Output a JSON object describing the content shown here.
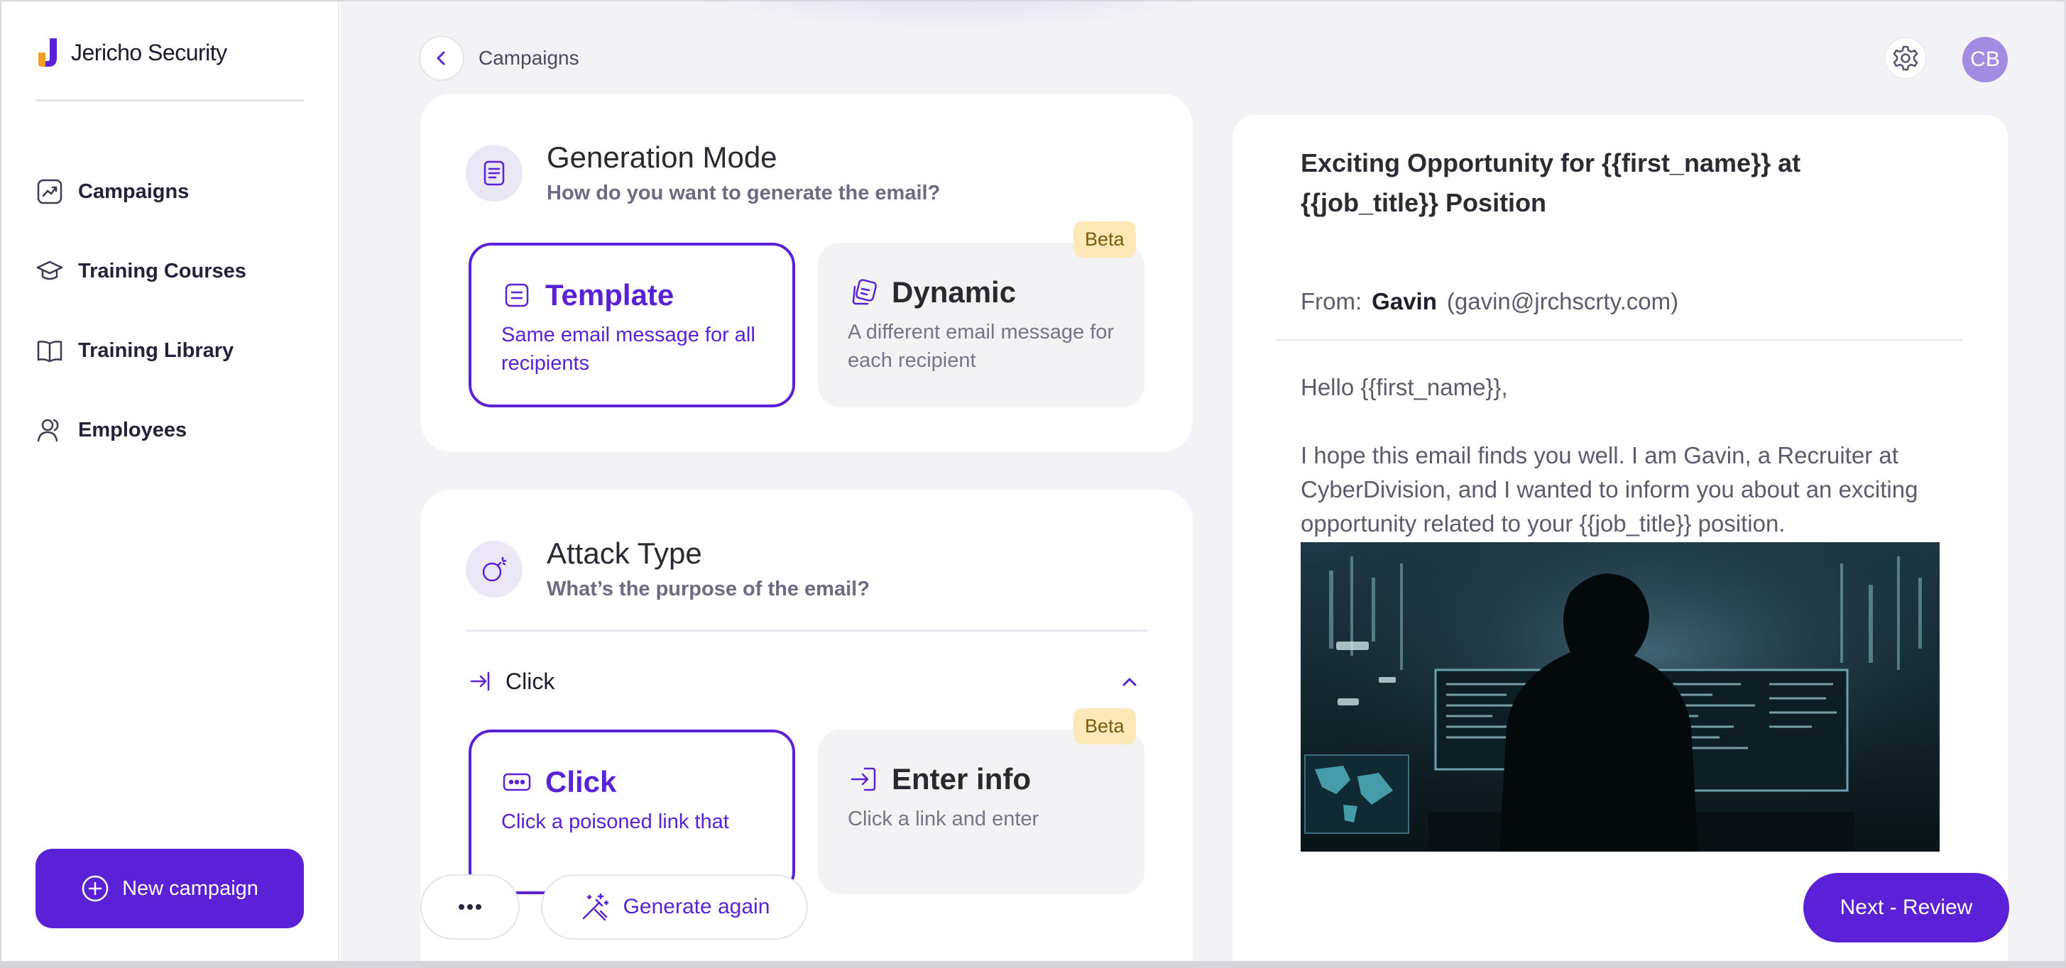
{
  "app": {
    "brand_name": "Jericho Security",
    "accent_color": "#5b21d6"
  },
  "sidebar": {
    "items": [
      {
        "label": "Campaigns",
        "icon": "trending-chart-icon"
      },
      {
        "label": "Training Courses",
        "icon": "graduation-cap-icon"
      },
      {
        "label": "Training Library",
        "icon": "open-book-icon"
      },
      {
        "label": "Employees",
        "icon": "users-icon"
      }
    ],
    "new_campaign_label": "New campaign"
  },
  "header": {
    "breadcrumb": "Campaigns",
    "avatar_initials": "CB"
  },
  "generation_mode": {
    "title": "Generation Mode",
    "subtitle": "How do you want to generate the email?",
    "options": [
      {
        "title": "Template",
        "description": "Same email message for all recipients",
        "selected": true
      },
      {
        "title": "Dynamic",
        "description": "A different email message for each recipient",
        "selected": false,
        "badge": "Beta"
      }
    ]
  },
  "attack_type": {
    "title": "Attack Type",
    "subtitle": "What’s the purpose of the email?",
    "dropdown_value": "Click",
    "options": [
      {
        "title": "Click",
        "description": "Click a poisoned link that",
        "selected": true
      },
      {
        "title": "Enter info",
        "description": "Click a link and enter",
        "selected": false,
        "badge": "Beta"
      }
    ]
  },
  "preview": {
    "subject": "Exciting Opportunity for {{first_name}} at {{job_title}} Position",
    "from_label": "From:",
    "from_name": "Gavin",
    "from_email": "(gavin@jrchscrty.com)",
    "greeting": "Hello {{first_name}},",
    "body": "I hope this email finds you well. I am Gavin, a Recruiter at CyberDivision, and I wanted to inform you about an exciting opportunity related to your {{job_title}} position."
  },
  "footer": {
    "generate_again_label": "Generate again",
    "next_label": "Next - Review"
  }
}
